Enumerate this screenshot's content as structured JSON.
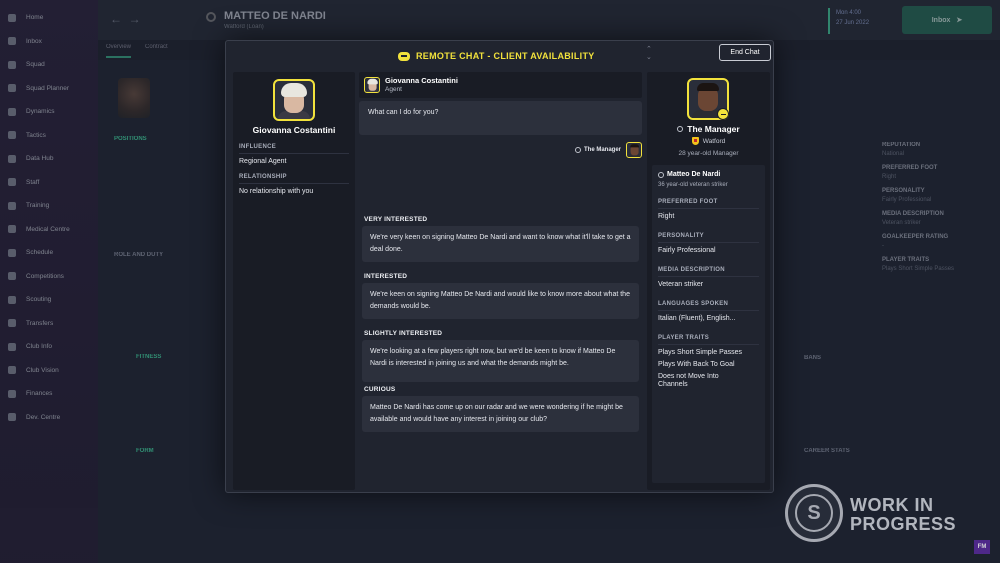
{
  "background": {
    "nav_items": [
      "Home",
      "Inbox",
      "Squad",
      "Squad Planner",
      "Dynamics",
      "Tactics",
      "Data Hub",
      "Staff",
      "Training",
      "Medical Centre",
      "Schedule",
      "Competitions",
      "Scouting",
      "Transfers",
      "Club Info",
      "Club Vision",
      "Finances",
      "Dev. Centre"
    ],
    "player_name": "MATTEO DE NARDI",
    "player_sub": "Watford (Loan)",
    "tabs": [
      "Overview",
      "Contract"
    ],
    "date_line1": "Mon 4:00",
    "date_line2": "27 Jun 2022",
    "continue_label": "Inbox",
    "right_list": [
      {
        "title": "REPUTATION",
        "value": "National"
      },
      {
        "title": "PREFERRED FOOT",
        "value": "Right"
      },
      {
        "title": "PERSONALITY",
        "value": "Fairly Professional"
      },
      {
        "title": "MEDIA DESCRIPTION",
        "value": "Veteran striker"
      },
      {
        "title": "GOALKEEPER RATING",
        "value": "-"
      },
      {
        "title": "PLAYER TRAITS",
        "value": "Plays Short Simple Passes"
      }
    ],
    "section_labels": [
      "POSITIONS",
      "ROLE AND DUTY",
      "FITNESS",
      "FORM",
      "BANS",
      "CAREER STATS"
    ],
    "badge_text": "WORK IN PROGRESS",
    "fm_logo": "FM",
    "accent": "#3fd6a0"
  },
  "modal": {
    "title": "REMOTE CHAT - CLIENT AVAILABILITY",
    "end_chat_label": "End Chat",
    "title_color": "#f2e23c"
  },
  "agent": {
    "name": "Giovanna Costantini",
    "role": "Agent",
    "influence_label": "INFLUENCE",
    "influence_value": "Regional Agent",
    "relationship_label": "RELATIONSHIP",
    "relationship_value": "No relationship with you"
  },
  "chat": {
    "agent_message": "What can I do for you?",
    "manager_tag": "The Manager",
    "options": [
      {
        "label": "VERY INTERESTED",
        "text": "We're very keen on signing Matteo De Nardi and want to know what it'll take to get a deal done."
      },
      {
        "label": "INTERESTED",
        "text": "We're keen on signing Matteo De Nardi and would like to know more about what the demands would be."
      },
      {
        "label": "SLIGHTLY INTERESTED",
        "text": "We're looking at a few players right now, but we'd be keen to know if Matteo De Nardi is interested in joining us and what the demands might be."
      },
      {
        "label": "CURIOUS",
        "text": "Matteo De Nardi has come up on our radar and we were wondering if he might be available and would have any interest in joining our club?"
      }
    ]
  },
  "manager": {
    "name": "The Manager",
    "club": "Watford",
    "age_line": "28 year-old Manager"
  },
  "subject": {
    "name": "Matteo De Nardi",
    "desc": "36 year-old veteran striker",
    "foot_label": "PREFERRED FOOT",
    "foot_value": "Right",
    "personality_label": "PERSONALITY",
    "personality_value": "Fairly Professional",
    "media_label": "MEDIA DESCRIPTION",
    "media_value": "Veteran striker",
    "languages_label": "LANGUAGES SPOKEN",
    "languages_value": "Italian (Fluent), English...",
    "traits_label": "PLAYER TRAITS",
    "traits": [
      "Plays Short Simple Passes",
      "Plays With Back To Goal",
      "Does not Move Into Channels"
    ]
  }
}
